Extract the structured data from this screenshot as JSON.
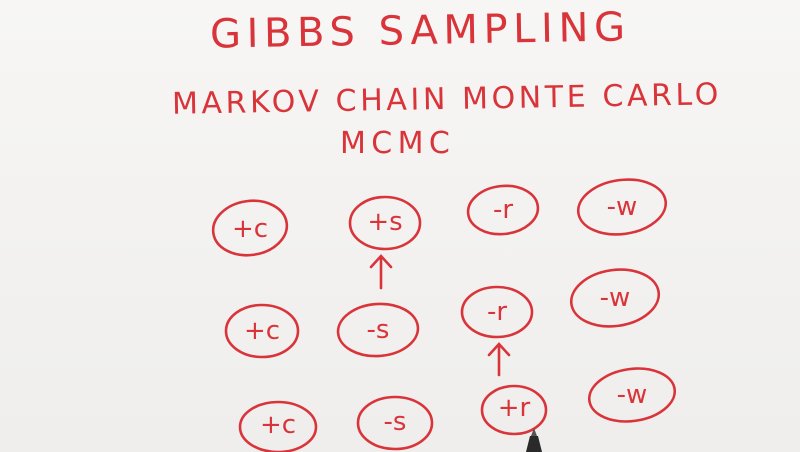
{
  "title": "GIBBS SAMPLING",
  "subtitle": "MARKOV CHAIN MONTE CARLO",
  "acronym": "MCMC",
  "rows": [
    [
      "+c",
      "+s",
      "-r",
      "-w"
    ],
    [
      "+c",
      "-s",
      "-r",
      "-w"
    ],
    [
      "+c",
      "-s",
      "+r",
      "-w"
    ]
  ],
  "ink_color": "#d8343a"
}
